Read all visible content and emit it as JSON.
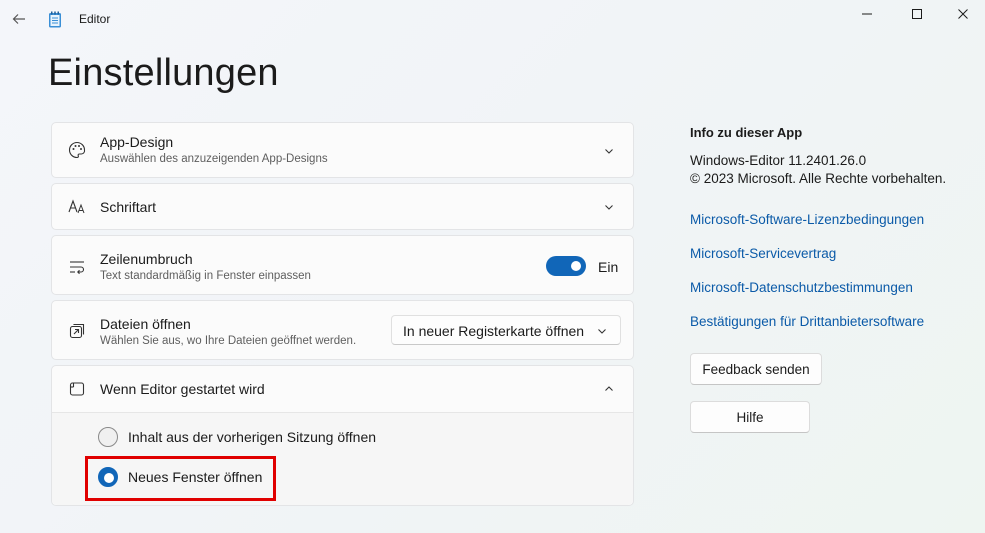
{
  "window": {
    "app_title": "Editor"
  },
  "page": {
    "title": "Einstellungen"
  },
  "settings": {
    "app_design": {
      "title": "App-Design",
      "subtitle": "Auswählen des anzuzeigenden App-Designs"
    },
    "font": {
      "title": "Schriftart"
    },
    "word_wrap": {
      "title": "Zeilenumbruch",
      "subtitle": "Text standardmäßig in Fenster einpassen",
      "toggle_label": "Ein",
      "enabled": true
    },
    "open_files": {
      "title": "Dateien öffnen",
      "subtitle": "Wählen Sie aus, wo Ihre Dateien geöffnet werden.",
      "selected": "In neuer Registerkarte öffnen"
    },
    "startup": {
      "title": "Wenn Editor gestartet wird",
      "options": [
        {
          "label": "Inhalt aus der vorherigen Sitzung öffnen",
          "checked": false
        },
        {
          "label": "Neues Fenster öffnen",
          "checked": true
        }
      ]
    }
  },
  "about": {
    "heading": "Info zu dieser App",
    "version": "Windows-Editor 11.2401.26.0",
    "copyright": "© 2023 Microsoft. Alle Rechte vorbehalten.",
    "links": [
      "Microsoft-Software-Lizenzbedingungen",
      "Microsoft-Servicevertrag",
      "Microsoft-Datenschutzbestimmungen",
      "Bestätigungen für Drittanbietersoftware"
    ],
    "feedback_button": "Feedback senden",
    "help_button": "Hilfe"
  },
  "colors": {
    "accent": "#1166b8",
    "link": "#0b5aa8",
    "highlight": "#e00000"
  }
}
